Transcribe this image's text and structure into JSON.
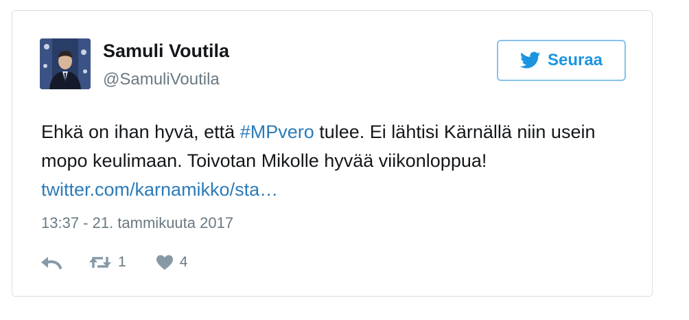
{
  "tweet": {
    "author_name": "Samuli Voutila",
    "author_handle": "@SamuliVoutila",
    "follow_label": "Seuraa",
    "text_before_hashtag": "Ehkä on ihan hyvä, että ",
    "hashtag": "#MPvero",
    "text_after_hashtag": " tulee. Ei lähtisi Kärnällä niin usein mopo keulimaan. Toivotan Mikolle hyvää viikonloppua! ",
    "link_text": "twitter.com/karnamikko/sta…",
    "timestamp": "13:37 - 21. tammikuuta 2017",
    "retweet_count": "1",
    "like_count": "4"
  },
  "icons": {
    "follow": "twitter-bird-icon",
    "reply": "reply-icon",
    "retweet": "retweet-icon",
    "like": "heart-icon"
  },
  "colors": {
    "link": "#2b7bb9",
    "follow_text": "#1c94e0",
    "follow_border": "#86c2ec",
    "muted": "#697882",
    "icon": "#8899a6"
  }
}
